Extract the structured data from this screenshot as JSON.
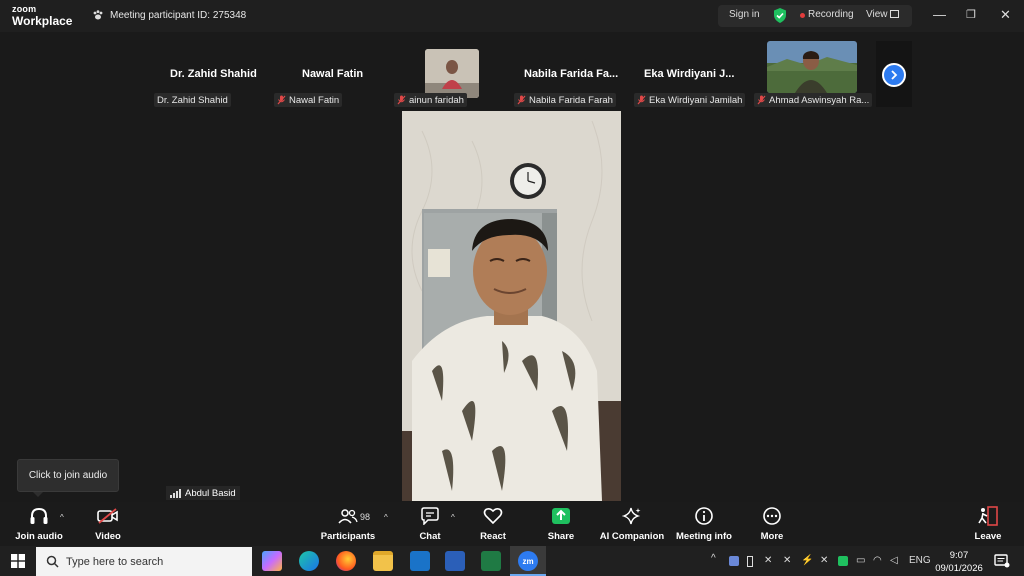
{
  "app": {
    "logo_line1": "zoom",
    "logo_line2": "Workplace",
    "meeting_id": "Meeting participant ID: 275348"
  },
  "titlebar": {
    "sign_in": "Sign in",
    "recording": "Recording",
    "view": "View"
  },
  "participants_strip": [
    {
      "big_name": "Dr. Zahid Shahid",
      "tag": "Dr. Zahid Shahid",
      "muted": false
    },
    {
      "big_name": "Nawal Fatin",
      "tag": "Nawal Fatin",
      "muted": true
    },
    {
      "big_name": "",
      "tag": "ainun faridah",
      "muted": true
    },
    {
      "big_name": "Nabila  Farida  Fa...",
      "tag": "Nabila Farida Farah",
      "muted": true
    },
    {
      "big_name": "Eka   Wirdiyani  J...",
      "tag": "Eka  Wirdiyani Jamilah",
      "muted": true
    },
    {
      "big_name": "",
      "tag": "Ahmad Aswinsyah Ra...",
      "muted": true
    }
  ],
  "main": {
    "speaker": "Abdul Basid",
    "tooltip": "Click to join audio"
  },
  "toolbar": {
    "join_audio": "Join audio",
    "video": "Video",
    "participants": "Participants",
    "participants_count": "98",
    "chat": "Chat",
    "react": "React",
    "share": "Share",
    "ai_companion": "AI Companion",
    "meeting_info": "Meeting info",
    "more": "More",
    "leave": "Leave"
  },
  "taskbar": {
    "search_placeholder": "Type here to search",
    "lang": "ENG",
    "time": "9:07",
    "date": "09/01/2026"
  },
  "colors": {
    "accent_blue": "#2d7bf0",
    "share_green": "#1fc05f",
    "record_red": "#e23c3c",
    "muted_red": "#e04848"
  }
}
